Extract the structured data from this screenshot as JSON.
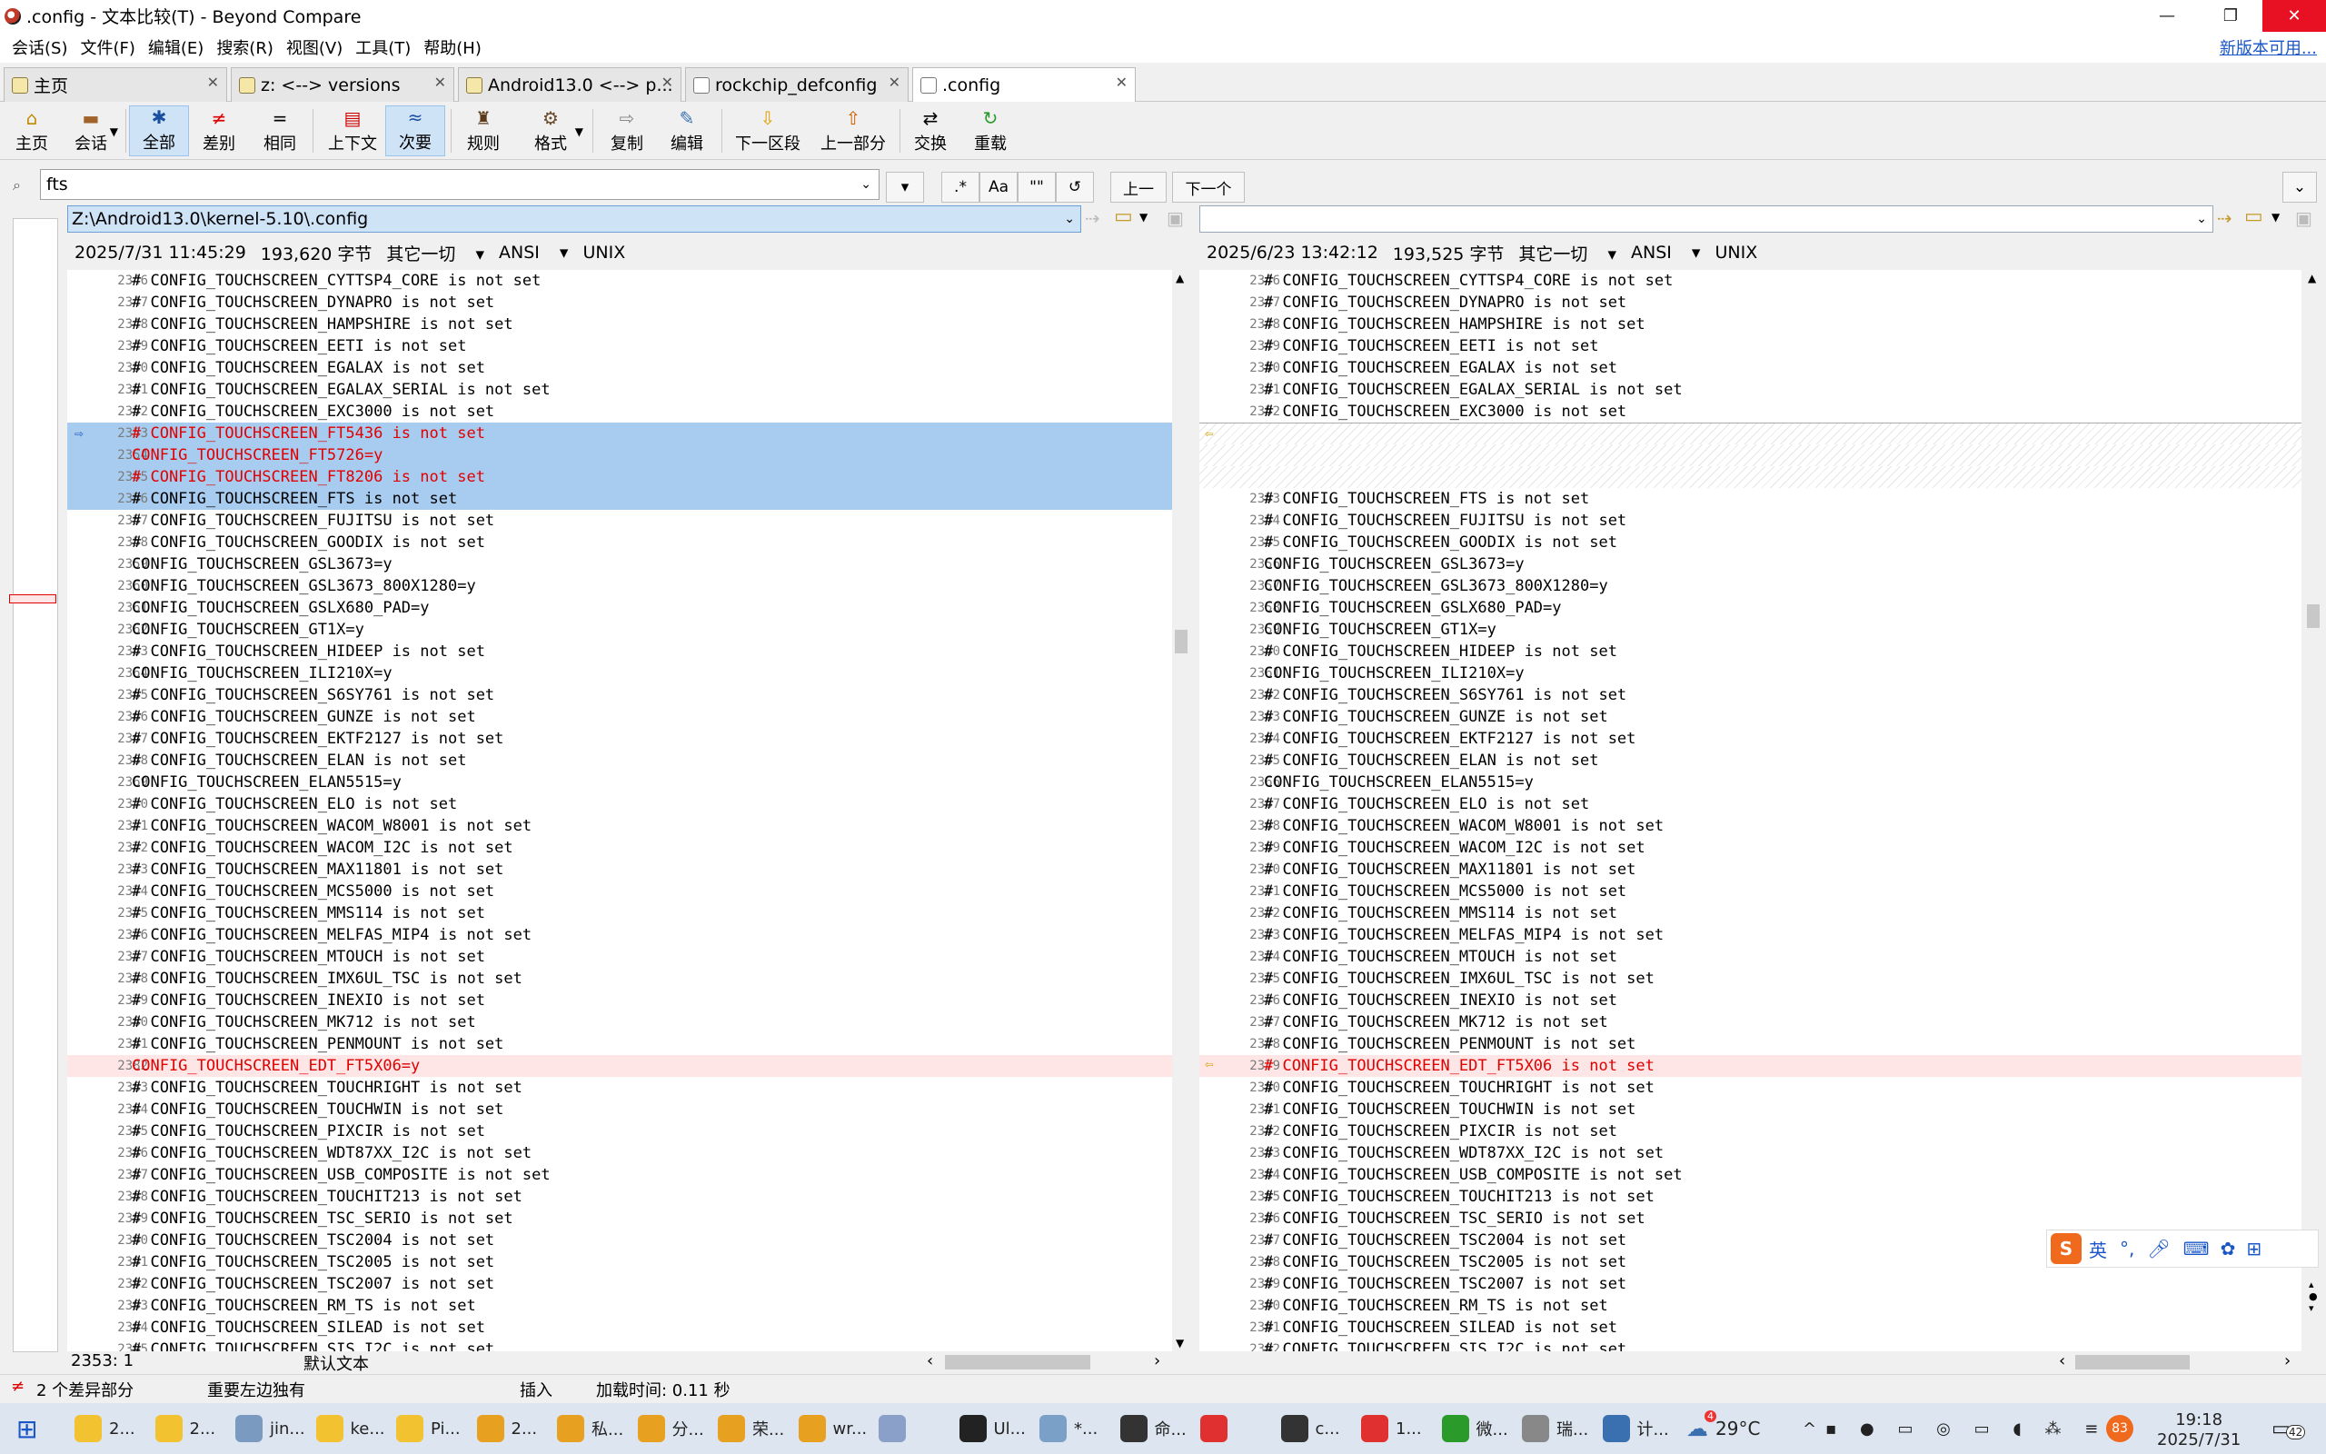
{
  "window": {
    "title": ".config - 文本比较(T) - Beyond Compare",
    "minimize": "—",
    "restore": "❐",
    "close": "✕"
  },
  "menu": {
    "items": [
      "会话(S)",
      "文件(F)",
      "编辑(E)",
      "搜索(R)",
      "视图(V)",
      "工具(T)",
      "帮助(H)"
    ],
    "new_version": "新版本可用..."
  },
  "tabs": [
    {
      "label": "主页"
    },
    {
      "label": "z: <--> versions"
    },
    {
      "label": "Android13.0 <--> p..."
    },
    {
      "label": "rockchip_defconfig"
    },
    {
      "label": ".config"
    }
  ],
  "toolbar": {
    "home": "主页",
    "session": "会话",
    "all": "全部",
    "diff": "差别",
    "same": "相同",
    "context": "上下文",
    "minor": "次要",
    "rules": "规则",
    "format": "格式",
    "copy": "复制",
    "edit": "编辑",
    "next_section": "下一区段",
    "prev_section": "上一部分",
    "swap": "交换",
    "reload": "重载"
  },
  "search": {
    "value": "fts",
    "prev": "上一",
    "next": "下一个",
    "regex": ".*",
    "case": "Aa",
    "word": "\"\""
  },
  "left": {
    "path": "Z:\\Android13.0\\kernel-5.10\\.config",
    "date": "2025/7/31 11:45:29",
    "size": "193,620 字节",
    "other": "其它一切",
    "encoding": "ANSI",
    "eol": "UNIX",
    "lines": [
      [
        "2346",
        "# CONFIG_TOUCHSCREEN_CYTTSP4_CORE is not set"
      ],
      [
        "2347",
        "# CONFIG_TOUCHSCREEN_DYNAPRO is not set"
      ],
      [
        "2348",
        "# CONFIG_TOUCHSCREEN_HAMPSHIRE is not set"
      ],
      [
        "2349",
        "# CONFIG_TOUCHSCREEN_EETI is not set"
      ],
      [
        "2350",
        "# CONFIG_TOUCHSCREEN_EGALAX is not set"
      ],
      [
        "2351",
        "# CONFIG_TOUCHSCREEN_EGALAX_SERIAL is not set"
      ],
      [
        "2352",
        "# CONFIG_TOUCHSCREEN_EXC3000 is not set"
      ],
      [
        "2353",
        "# CONFIG_TOUCHSCREEN_FT5436 is not set"
      ],
      [
        "2354",
        "CONFIG_TOUCHSCREEN_FT5726=y"
      ],
      [
        "2355",
        "# CONFIG_TOUCHSCREEN_FT8206 is not set"
      ],
      [
        "2356",
        "# CONFIG_TOUCHSCREEN_FTS is not set"
      ],
      [
        "2357",
        "# CONFIG_TOUCHSCREEN_FUJITSU is not set"
      ],
      [
        "2358",
        "# CONFIG_TOUCHSCREEN_GOODIX is not set"
      ],
      [
        "2359",
        "CONFIG_TOUCHSCREEN_GSL3673=y"
      ],
      [
        "2360",
        "CONFIG_TOUCHSCREEN_GSL3673_800X1280=y"
      ],
      [
        "2361",
        "CONFIG_TOUCHSCREEN_GSLX680_PAD=y"
      ],
      [
        "2362",
        "CONFIG_TOUCHSCREEN_GT1X=y"
      ],
      [
        "2363",
        "# CONFIG_TOUCHSCREEN_HIDEEP is not set"
      ],
      [
        "2364",
        "CONFIG_TOUCHSCREEN_ILI210X=y"
      ],
      [
        "2365",
        "# CONFIG_TOUCHSCREEN_S6SY761 is not set"
      ],
      [
        "2366",
        "# CONFIG_TOUCHSCREEN_GUNZE is not set"
      ],
      [
        "2367",
        "# CONFIG_TOUCHSCREEN_EKTF2127 is not set"
      ],
      [
        "2368",
        "# CONFIG_TOUCHSCREEN_ELAN is not set"
      ],
      [
        "2369",
        "CONFIG_TOUCHSCREEN_ELAN5515=y"
      ],
      [
        "2370",
        "# CONFIG_TOUCHSCREEN_ELO is not set"
      ],
      [
        "2371",
        "# CONFIG_TOUCHSCREEN_WACOM_W8001 is not set"
      ],
      [
        "2372",
        "# CONFIG_TOUCHSCREEN_WACOM_I2C is not set"
      ],
      [
        "2373",
        "# CONFIG_TOUCHSCREEN_MAX11801 is not set"
      ],
      [
        "2374",
        "# CONFIG_TOUCHSCREEN_MCS5000 is not set"
      ],
      [
        "2375",
        "# CONFIG_TOUCHSCREEN_MMS114 is not set"
      ],
      [
        "2376",
        "# CONFIG_TOUCHSCREEN_MELFAS_MIP4 is not set"
      ],
      [
        "2377",
        "# CONFIG_TOUCHSCREEN_MTOUCH is not set"
      ],
      [
        "2378",
        "# CONFIG_TOUCHSCREEN_IMX6UL_TSC is not set"
      ],
      [
        "2379",
        "# CONFIG_TOUCHSCREEN_INEXIO is not set"
      ],
      [
        "2380",
        "# CONFIG_TOUCHSCREEN_MK712 is not set"
      ],
      [
        "2381",
        "# CONFIG_TOUCHSCREEN_PENMOUNT is not set"
      ],
      [
        "2382",
        "CONFIG_TOUCHSCREEN_EDT_FT5X06=y"
      ],
      [
        "2383",
        "# CONFIG_TOUCHSCREEN_TOUCHRIGHT is not set"
      ],
      [
        "2384",
        "# CONFIG_TOUCHSCREEN_TOUCHWIN is not set"
      ],
      [
        "2385",
        "# CONFIG_TOUCHSCREEN_PIXCIR is not set"
      ],
      [
        "2386",
        "# CONFIG_TOUCHSCREEN_WDT87XX_I2C is not set"
      ],
      [
        "2387",
        "# CONFIG_TOUCHSCREEN_USB_COMPOSITE is not set"
      ],
      [
        "2388",
        "# CONFIG_TOUCHSCREEN_TOUCHIT213 is not set"
      ],
      [
        "2389",
        "# CONFIG_TOUCHSCREEN_TSC_SERIO is not set"
      ],
      [
        "2390",
        "# CONFIG_TOUCHSCREEN_TSC2004 is not set"
      ],
      [
        "2391",
        "# CONFIG_TOUCHSCREEN_TSC2005 is not set"
      ],
      [
        "2392",
        "# CONFIG_TOUCHSCREEN_TSC2007 is not set"
      ],
      [
        "2393",
        "# CONFIG_TOUCHSCREEN_RM_TS is not set"
      ],
      [
        "2394",
        "# CONFIG_TOUCHSCREEN_SILEAD is not set"
      ],
      [
        "2395",
        "# CONFIG_TOUCHSCREEN_SIS_I2C is not set"
      ]
    ]
  },
  "right": {
    "path": "",
    "date": "2025/6/23 13:42:12",
    "size": "193,525 字节",
    "other": "其它一切",
    "encoding": "ANSI",
    "eol": "UNIX",
    "lines": [
      [
        "2346",
        "# CONFIG_TOUCHSCREEN_CYTTSP4_CORE is not set"
      ],
      [
        "2347",
        "# CONFIG_TOUCHSCREEN_DYNAPRO is not set"
      ],
      [
        "2348",
        "# CONFIG_TOUCHSCREEN_HAMPSHIRE is not set"
      ],
      [
        "2349",
        "# CONFIG_TOUCHSCREEN_EETI is not set"
      ],
      [
        "2350",
        "# CONFIG_TOUCHSCREEN_EGALAX is not set"
      ],
      [
        "2351",
        "# CONFIG_TOUCHSCREEN_EGALAX_SERIAL is not set"
      ],
      [
        "2352",
        "# CONFIG_TOUCHSCREEN_EXC3000 is not set"
      ],
      [
        "",
        ""
      ],
      [
        "",
        ""
      ],
      [
        "",
        ""
      ],
      [
        "2353",
        "# CONFIG_TOUCHSCREEN_FTS is not set"
      ],
      [
        "2354",
        "# CONFIG_TOUCHSCREEN_FUJITSU is not set"
      ],
      [
        "2355",
        "# CONFIG_TOUCHSCREEN_GOODIX is not set"
      ],
      [
        "2356",
        "CONFIG_TOUCHSCREEN_GSL3673=y"
      ],
      [
        "2357",
        "CONFIG_TOUCHSCREEN_GSL3673_800X1280=y"
      ],
      [
        "2358",
        "CONFIG_TOUCHSCREEN_GSLX680_PAD=y"
      ],
      [
        "2359",
        "CONFIG_TOUCHSCREEN_GT1X=y"
      ],
      [
        "2360",
        "# CONFIG_TOUCHSCREEN_HIDEEP is not set"
      ],
      [
        "2361",
        "CONFIG_TOUCHSCREEN_ILI210X=y"
      ],
      [
        "2362",
        "# CONFIG_TOUCHSCREEN_S6SY761 is not set"
      ],
      [
        "2363",
        "# CONFIG_TOUCHSCREEN_GUNZE is not set"
      ],
      [
        "2364",
        "# CONFIG_TOUCHSCREEN_EKTF2127 is not set"
      ],
      [
        "2365",
        "# CONFIG_TOUCHSCREEN_ELAN is not set"
      ],
      [
        "2366",
        "CONFIG_TOUCHSCREEN_ELAN5515=y"
      ],
      [
        "2367",
        "# CONFIG_TOUCHSCREEN_ELO is not set"
      ],
      [
        "2368",
        "# CONFIG_TOUCHSCREEN_WACOM_W8001 is not set"
      ],
      [
        "2369",
        "# CONFIG_TOUCHSCREEN_WACOM_I2C is not set"
      ],
      [
        "2370",
        "# CONFIG_TOUCHSCREEN_MAX11801 is not set"
      ],
      [
        "2371",
        "# CONFIG_TOUCHSCREEN_MCS5000 is not set"
      ],
      [
        "2372",
        "# CONFIG_TOUCHSCREEN_MMS114 is not set"
      ],
      [
        "2373",
        "# CONFIG_TOUCHSCREEN_MELFAS_MIP4 is not set"
      ],
      [
        "2374",
        "# CONFIG_TOUCHSCREEN_MTOUCH is not set"
      ],
      [
        "2375",
        "# CONFIG_TOUCHSCREEN_IMX6UL_TSC is not set"
      ],
      [
        "2376",
        "# CONFIG_TOUCHSCREEN_INEXIO is not set"
      ],
      [
        "2377",
        "# CONFIG_TOUCHSCREEN_MK712 is not set"
      ],
      [
        "2378",
        "# CONFIG_TOUCHSCREEN_PENMOUNT is not set"
      ],
      [
        "2379",
        "# CONFIG_TOUCHSCREEN_EDT_FT5X06 is not set"
      ],
      [
        "2380",
        "# CONFIG_TOUCHSCREEN_TOUCHRIGHT is not set"
      ],
      [
        "2381",
        "# CONFIG_TOUCHSCREEN_TOUCHWIN is not set"
      ],
      [
        "2382",
        "# CONFIG_TOUCHSCREEN_PIXCIR is not set"
      ],
      [
        "2383",
        "# CONFIG_TOUCHSCREEN_WDT87XX_I2C is not set"
      ],
      [
        "2384",
        "# CONFIG_TOUCHSCREEN_USB_COMPOSITE is not set"
      ],
      [
        "2385",
        "# CONFIG_TOUCHSCREEN_TOUCHIT213 is not set"
      ],
      [
        "2386",
        "# CONFIG_TOUCHSCREEN_TSC_SERIO is not set"
      ],
      [
        "2387",
        "# CONFIG_TOUCHSCREEN_TSC2004 is not set"
      ],
      [
        "2388",
        "# CONFIG_TOUCHSCREEN_TSC2005 is not set"
      ],
      [
        "2389",
        "# CONFIG_TOUCHSCREEN_TSC2007 is not set"
      ],
      [
        "2390",
        "# CONFIG_TOUCHSCREEN_RM_TS is not set"
      ],
      [
        "2391",
        "# CONFIG_TOUCHSCREEN_SILEAD is not set"
      ],
      [
        "2392",
        "# CONFIG_TOUCHSCREEN_SIS_I2C is not set"
      ]
    ]
  },
  "status": {
    "cursor": "2353: 1",
    "text_format": "默认文本",
    "diff_count": "2 个差异部分",
    "important": "重要左边独有",
    "insert": "插入",
    "load_time": "加载时间: 0.11 秒"
  },
  "taskbar": {
    "items": [
      "2...",
      "2...",
      "jin...",
      "ke...",
      "Pi...",
      "2...",
      "私...",
      "分...",
      "荣...",
      "wr...",
      "",
      "Ul...",
      "*...",
      "命...",
      "",
      "c...",
      "1...",
      "微...",
      "瑞...",
      "计..."
    ],
    "weather": "29°C",
    "weather_badge": "4",
    "time": "19:18",
    "date": "2025/7/31",
    "notif": "42",
    "tray_badge": "83"
  },
  "ime": {
    "lang": "英"
  }
}
